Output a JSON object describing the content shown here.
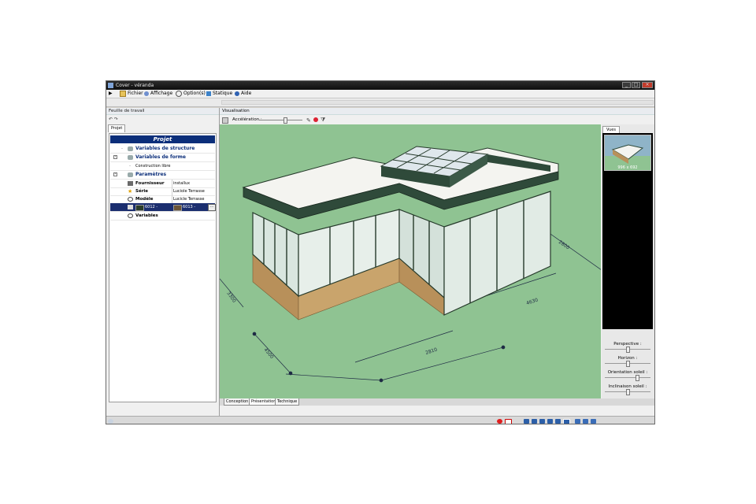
{
  "window": {
    "title": "Cover - véranda"
  },
  "menu": [
    {
      "label": "Fichier",
      "icon": "folder-icon"
    },
    {
      "label": "Affichage",
      "icon": "eye-icon"
    },
    {
      "label": "Option(s)",
      "icon": "options-icon"
    },
    {
      "label": "Statique",
      "icon": "monitor-icon"
    },
    {
      "label": "Aide",
      "icon": "help-icon"
    }
  ],
  "left_panel": {
    "title": "Feuille de travail",
    "tab": "Projet",
    "header": "Projet",
    "rows": [
      {
        "label": "Variables de structure",
        "kind": "section"
      },
      {
        "label": "Variables de forme",
        "kind": "section"
      },
      {
        "label": "Construction libre",
        "kind": "plain"
      },
      {
        "label": "Paramètres",
        "kind": "section"
      },
      {
        "label": "Fournisseur",
        "value": "installux"
      },
      {
        "label": "Série",
        "value": "Luciole Terrasse"
      },
      {
        "label": "Modèle",
        "value": "Lucicle Terrasse"
      },
      {
        "label": "6012 -",
        "value": "6013 -",
        "extra": "..."
      },
      {
        "label": "Variables",
        "kind": "bold"
      }
    ]
  },
  "visualisation": {
    "title": "Visualisation",
    "acceleration_label": "Accélération :",
    "acceleration_level": 0.6,
    "dimensions": [
      "3300",
      "4500",
      "2810",
      "4630",
      "2800"
    ]
  },
  "right_panel": {
    "tab": "Vues",
    "thumbnail_caption": "996 x 692",
    "sliders": [
      {
        "label": "Perspective :",
        "value": 0.5
      },
      {
        "label": "Horizon :",
        "value": 0.5
      },
      {
        "label": "Orientation soleil :",
        "value": 0.7
      },
      {
        "label": "Inclinaison soleil :",
        "value": 0.5
      }
    ]
  },
  "bottom_tabs": [
    "Conception",
    "Présentation",
    "Technique"
  ]
}
